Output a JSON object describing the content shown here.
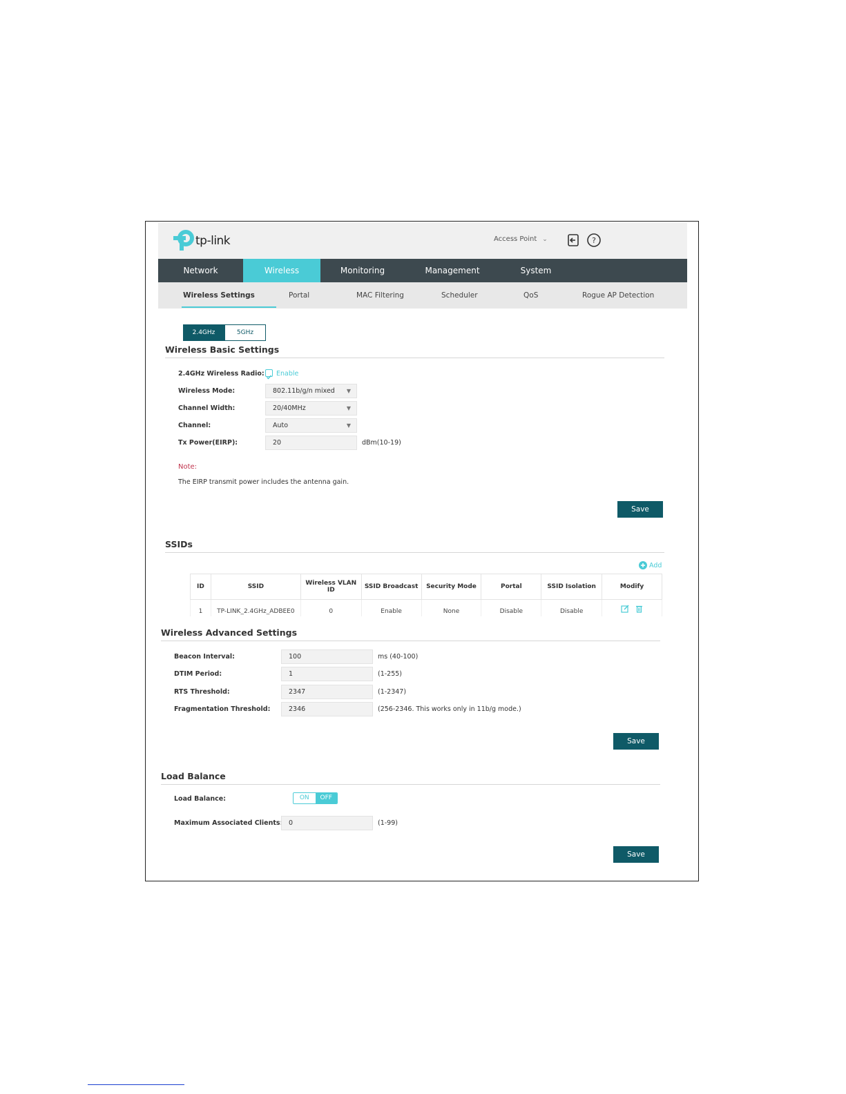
{
  "header": {
    "brand": "tp-link",
    "mode_select": "Access Point",
    "colors": {
      "accent": "#4acbd6",
      "nav_bg": "#3d494f",
      "button": "#0f5a67"
    }
  },
  "nav": {
    "items": [
      {
        "label": "Network"
      },
      {
        "label": "Wireless"
      },
      {
        "label": "Monitoring"
      },
      {
        "label": "Management"
      },
      {
        "label": "System"
      }
    ],
    "active": "Wireless"
  },
  "subnav": {
    "items": [
      {
        "label": "Wireless Settings"
      },
      {
        "label": "Portal"
      },
      {
        "label": "MAC Filtering"
      },
      {
        "label": "Scheduler"
      },
      {
        "label": "QoS"
      },
      {
        "label": "Rogue AP Detection"
      }
    ],
    "active": "Wireless Settings"
  },
  "band_tabs": [
    {
      "label": "2.4GHz"
    },
    {
      "label": "5GHz"
    }
  ],
  "basic": {
    "title": "Wireless Basic Settings",
    "radio_label": "2.4GHz Wireless Radio:",
    "radio_enable": "Enable",
    "mode_label": "Wireless Mode:",
    "mode_value": "802.11b/g/n mixed",
    "width_label": "Channel Width:",
    "width_value": "20/40MHz",
    "channel_label": "Channel:",
    "channel_value": "Auto",
    "power_label": "Tx Power(EIRP):",
    "power_value": "20",
    "power_hint": "dBm(10-19)",
    "note_title": "Note:",
    "note_text": "The EIRP transmit power includes the antenna gain.",
    "save": "Save"
  },
  "ssids": {
    "title": "SSIDs",
    "add": "Add",
    "headers": [
      "ID",
      "SSID",
      "Wireless VLAN ID",
      "SSID Broadcast",
      "Security Mode",
      "Portal",
      "SSID Isolation",
      "Modify"
    ],
    "row": [
      "1",
      "TP-LINK_2.4GHz_ADBEE0",
      "0",
      "Enable",
      "None",
      "Disable",
      "Disable"
    ]
  },
  "advanced": {
    "title": "Wireless Advanced Settings",
    "beacon_label": "Beacon Interval:",
    "beacon_value": "100",
    "beacon_hint": "ms (40-100)",
    "dtim_label": "DTIM Period:",
    "dtim_value": "1",
    "dtim_hint": "(1-255)",
    "rts_label": "RTS Threshold:",
    "rts_value": "2347",
    "rts_hint": "(1-2347)",
    "frag_label": "Fragmentation Threshold:",
    "frag_value": "2346",
    "frag_hint": "(256-2346. This works only in 11b/g mode.)",
    "save": "Save"
  },
  "load_balance": {
    "title": "Load Balance",
    "label": "Load Balance:",
    "on": "ON",
    "off": "OFF",
    "max_label": "Maximum Associated Clients:",
    "max_value": "0",
    "max_hint": "(1-99)",
    "save": "Save"
  }
}
